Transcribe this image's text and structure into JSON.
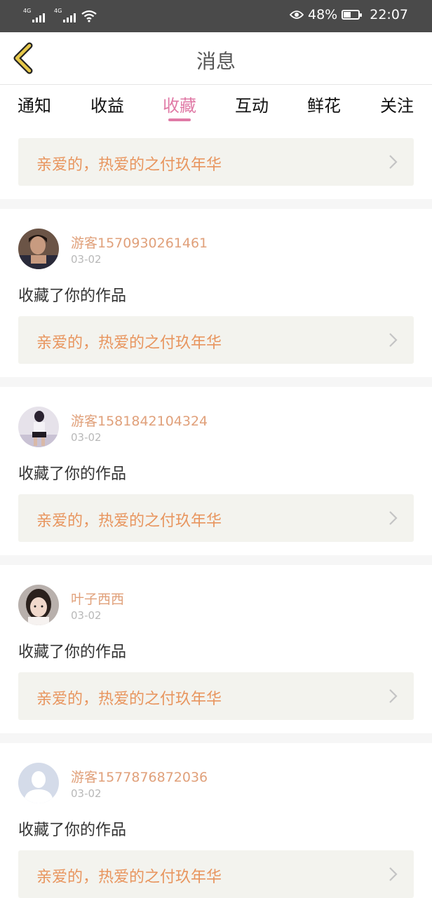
{
  "status_bar": {
    "signal1_label": "4G",
    "signal2_label": "4G",
    "battery_percent": "48%",
    "battery_level": 0.48,
    "time": "22:07"
  },
  "header": {
    "title": "消息",
    "back_icon": "chevron-left-icon"
  },
  "tabs": [
    {
      "label": "通知",
      "active": false
    },
    {
      "label": "收益",
      "active": false
    },
    {
      "label": "收藏",
      "active": true
    },
    {
      "label": "互动",
      "active": false
    },
    {
      "label": "鲜花",
      "active": false
    },
    {
      "label": "关注",
      "active": false
    }
  ],
  "top_card": {
    "work_title": "亲爱的，热爱的之付玖年华"
  },
  "messages": [
    {
      "user": "游客1570930261461",
      "date": "03-02",
      "action": "收藏了你的作品",
      "work_title": "亲爱的，热爱的之付玖年华"
    },
    {
      "user": "游客1581842104324",
      "date": "03-02",
      "action": "收藏了你的作品",
      "work_title": "亲爱的，热爱的之付玖年华"
    },
    {
      "user": "叶子西西",
      "date": "03-02",
      "action": "收藏了你的作品",
      "work_title": "亲爱的，热爱的之付玖年华"
    },
    {
      "user": "游客1577876872036",
      "date": "03-02",
      "action": "收藏了你的作品",
      "work_title": "亲爱的，热爱的之付玖年华"
    }
  ],
  "colors": {
    "accent": "#e07aa6",
    "link_text": "#e8955e",
    "username": "#e0a07a",
    "back_arrow": "#e6c84a"
  }
}
